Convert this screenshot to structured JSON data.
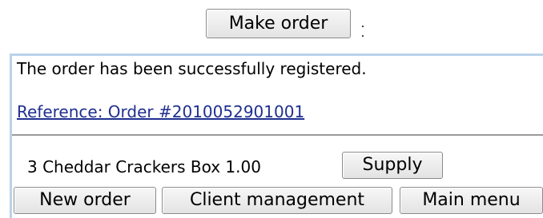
{
  "top": {
    "make_order_label": "Make order",
    "suffix": ":"
  },
  "result": {
    "message": "The order has been successfully registered.",
    "reference_link": "Reference: Order #2010052901001"
  },
  "item": {
    "description": "3 Cheddar Crackers Box 1.00",
    "supply_label": "Supply"
  },
  "nav": {
    "new_order_label": "New order",
    "client_management_label": "Client management",
    "main_menu_label": "Main menu"
  },
  "colors": {
    "panel_border": "#b9d3ea",
    "link": "#1f2f8f",
    "button_border": "#8c8c8c"
  }
}
